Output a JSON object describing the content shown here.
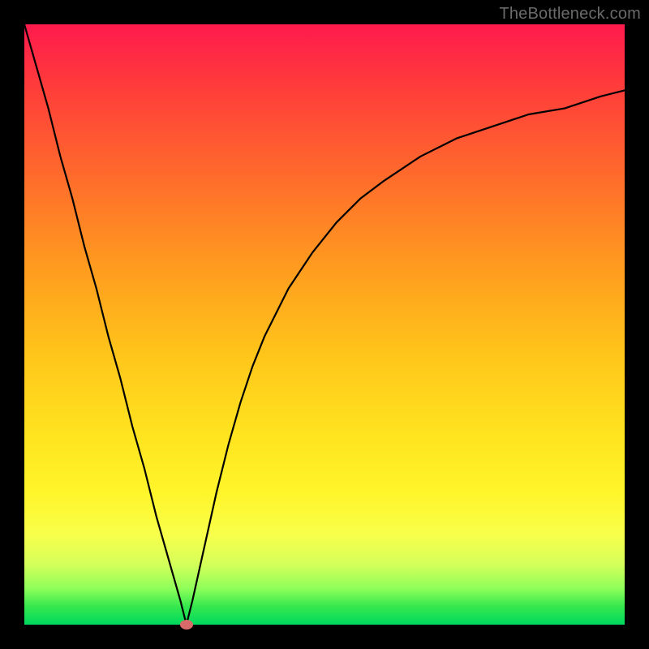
{
  "watermark": "TheBottleneck.com",
  "chart_data": {
    "type": "line",
    "title": "",
    "xlabel": "",
    "ylabel": "",
    "xlim": [
      0,
      100
    ],
    "ylim": [
      0,
      100
    ],
    "grid": false,
    "legend": false,
    "series": [
      {
        "name": "curve",
        "x": [
          0,
          2,
          4,
          6,
          8,
          10,
          12,
          14,
          16,
          18,
          20,
          22,
          24,
          26,
          27,
          28,
          30,
          32,
          34,
          36,
          38,
          40,
          44,
          48,
          52,
          56,
          60,
          66,
          72,
          78,
          84,
          90,
          96,
          100
        ],
        "values": [
          100,
          93,
          86,
          78,
          71,
          63,
          56,
          48,
          41,
          33,
          26,
          18,
          11,
          4,
          0,
          4,
          13,
          22,
          30,
          37,
          43,
          48,
          56,
          62,
          67,
          71,
          74,
          78,
          81,
          83,
          85,
          86,
          88,
          89
        ]
      }
    ],
    "marker": {
      "x": 27,
      "y": 0,
      "color": "#d96a6a"
    },
    "background_gradient": {
      "top": "#ff1a4d",
      "middle": "#ffe31f",
      "bottom": "#00d85e"
    },
    "frame_color": "#000000"
  }
}
